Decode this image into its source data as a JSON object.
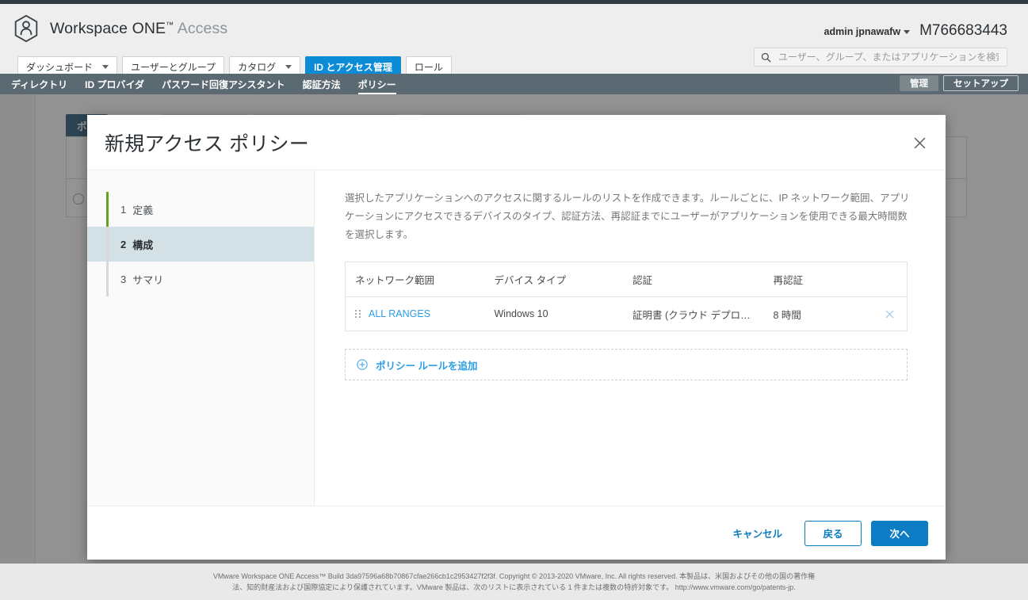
{
  "brand": {
    "name": "Workspace ONE",
    "tm": "™",
    "product": "Access",
    "logo_icon": "workspace-one-hexagon-person-icon"
  },
  "header": {
    "user_name": "admin jpnawafw",
    "tenant_id": "M766683443",
    "search": {
      "placeholder": "ユーザー、グループ、またはアプリケーションを検索",
      "value": "",
      "icon": "search-icon"
    }
  },
  "nav_tabs": [
    {
      "label": "ダッシュボード",
      "has_caret": true,
      "active": false
    },
    {
      "label": "ユーザーとグループ",
      "has_caret": false,
      "active": false
    },
    {
      "label": "カタログ",
      "has_caret": true,
      "active": false
    },
    {
      "label": "ID とアクセス管理",
      "has_caret": false,
      "active": true
    },
    {
      "label": "ロール",
      "has_caret": false,
      "active": false
    }
  ],
  "subnav": {
    "items": [
      {
        "label": "ディレクトリ",
        "active": false
      },
      {
        "label": "ID プロバイダ",
        "active": false
      },
      {
        "label": "パスワード回復アシスタント",
        "active": false
      },
      {
        "label": "認証方法",
        "active": false
      },
      {
        "label": "ポリシー",
        "active": true
      }
    ],
    "right_buttons": [
      {
        "label": "管理",
        "selected": true
      },
      {
        "label": "セットアップ",
        "selected": false
      }
    ]
  },
  "background": {
    "tab_label": "ポ…"
  },
  "modal": {
    "title": "新規アクセス ポリシー",
    "close_icon": "close-icon",
    "steps": [
      {
        "num": "1",
        "label": "定義",
        "state": "done"
      },
      {
        "num": "2",
        "label": "構成",
        "state": "active"
      },
      {
        "num": "3",
        "label": "サマリ",
        "state": "pending"
      }
    ],
    "description": "選択したアプリケーションへのアクセスに関するルールのリストを作成できます。ルールごとに、IP ネットワーク範囲、アプリケーションにアクセスできるデバイスのタイプ、認証方法、再認証までにユーザーがアプリケーションを使用できる最大時間数を選択します。",
    "table": {
      "columns": [
        "ネットワーク範囲",
        "デバイス タイプ",
        "認証",
        "再認証"
      ],
      "rows": [
        {
          "drag_handle": "drag-handle-icon",
          "network_range": "ALL RANGES",
          "device_type": "Windows 10",
          "authentication": "証明書 (クラウド デプロ…",
          "reauth": "8 時間",
          "remove_icon": "remove-row-icon"
        }
      ]
    },
    "add_rule": {
      "icon": "plus-circle-icon",
      "label": "ポリシー ルールを追加"
    },
    "buttons": {
      "cancel": "キャンセル",
      "back": "戻る",
      "next": "次へ"
    }
  },
  "footer": {
    "line1": "VMware Workspace ONE Access™ Build 3da97596a68b70867cfae266cb1c2953427f2f3f. Copyright © 2013-2020 VMware, Inc. All rights reserved. 本製品は、米国およびその他の国の著作権",
    "line2": "法、知的財産法および国際協定により保護されています。VMware 製品は、次のリストに表示されている 1 件または複数の特許対象です。  http://www.vmware.com/go/patents-jp."
  },
  "colors": {
    "accent_blue": "#0c8bd6",
    "primary_button": "#0c7cc4",
    "link_blue": "#2b9de8",
    "subnav_bg": "#5b6a72",
    "step_done_green": "#62a420",
    "step_active_bg": "#d3e0e6"
  }
}
